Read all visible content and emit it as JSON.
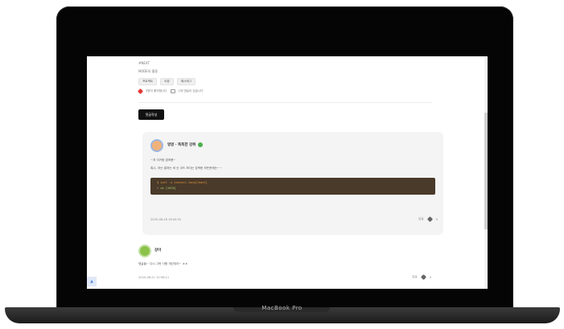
{
  "device": {
    "brand_label": "MacBook Pro"
  },
  "post": {
    "meta_line_1": "#NEXT",
    "meta_line_2": "NODE의 활용",
    "tags": [
      "프로젝트",
      "리뷰",
      "해시태그"
    ],
    "reaction_likes": "3명이 좋아합니다",
    "reaction_comments": "2개 댓글이 있습니다"
  },
  "comments_section": {
    "write_button": "댓글작성",
    "comment_1": {
      "author": "멍멍 · 똑똑한 강쥐",
      "line_1": "~저 이거랑 겹쳐용~",
      "line_2": "혹시, 저는 결과는 비 슷 코드 보다는 강력한 모든문제는~~",
      "code_line_1": "$ curl -s install.loca[lhost]",
      "code_line_2": "> ok [2020]",
      "date": "2020-08-18 16:00:31",
      "reply_label": "답글",
      "like_count": "0"
    },
    "comment_2": {
      "author": "강아",
      "text": "댓글을~ 다시 그런 사항 개선되어~ ㅎㅎ",
      "date": "2020-08-21 12:58:11",
      "reply_label": "답글",
      "like_count": "0"
    },
    "corner_icon": "up-arrow-icon"
  },
  "colors": {
    "accent_heart": "#e53935",
    "button_dark": "#111111",
    "code_bg": "#4a3a2a",
    "verified": "#4caf50"
  }
}
